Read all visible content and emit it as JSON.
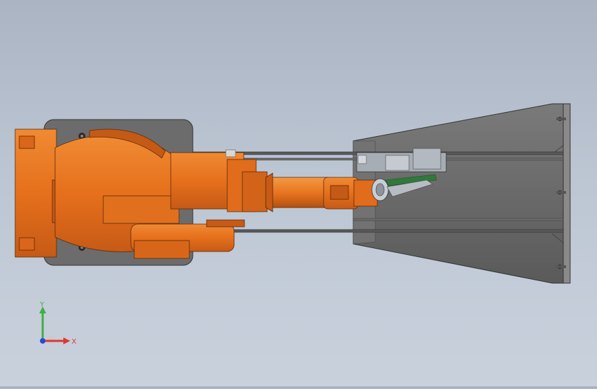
{
  "viewport": {
    "model_part": "robot-cell-assembly"
  },
  "triad": {
    "y_label": "Y",
    "x_label": "X",
    "y_color": "#3cb043",
    "x_color": "#e0362c",
    "z_color": "#2748d8"
  },
  "colors": {
    "robot_orange": "#e8741e",
    "robot_orange_dark": "#b9561a",
    "base_plate": "#6b6b6b",
    "fixture_plate": "#6f6f6f",
    "rail": "#4a4a4a",
    "gripper": "#9aa0a8",
    "gripper_green": "#2f7a3a"
  }
}
